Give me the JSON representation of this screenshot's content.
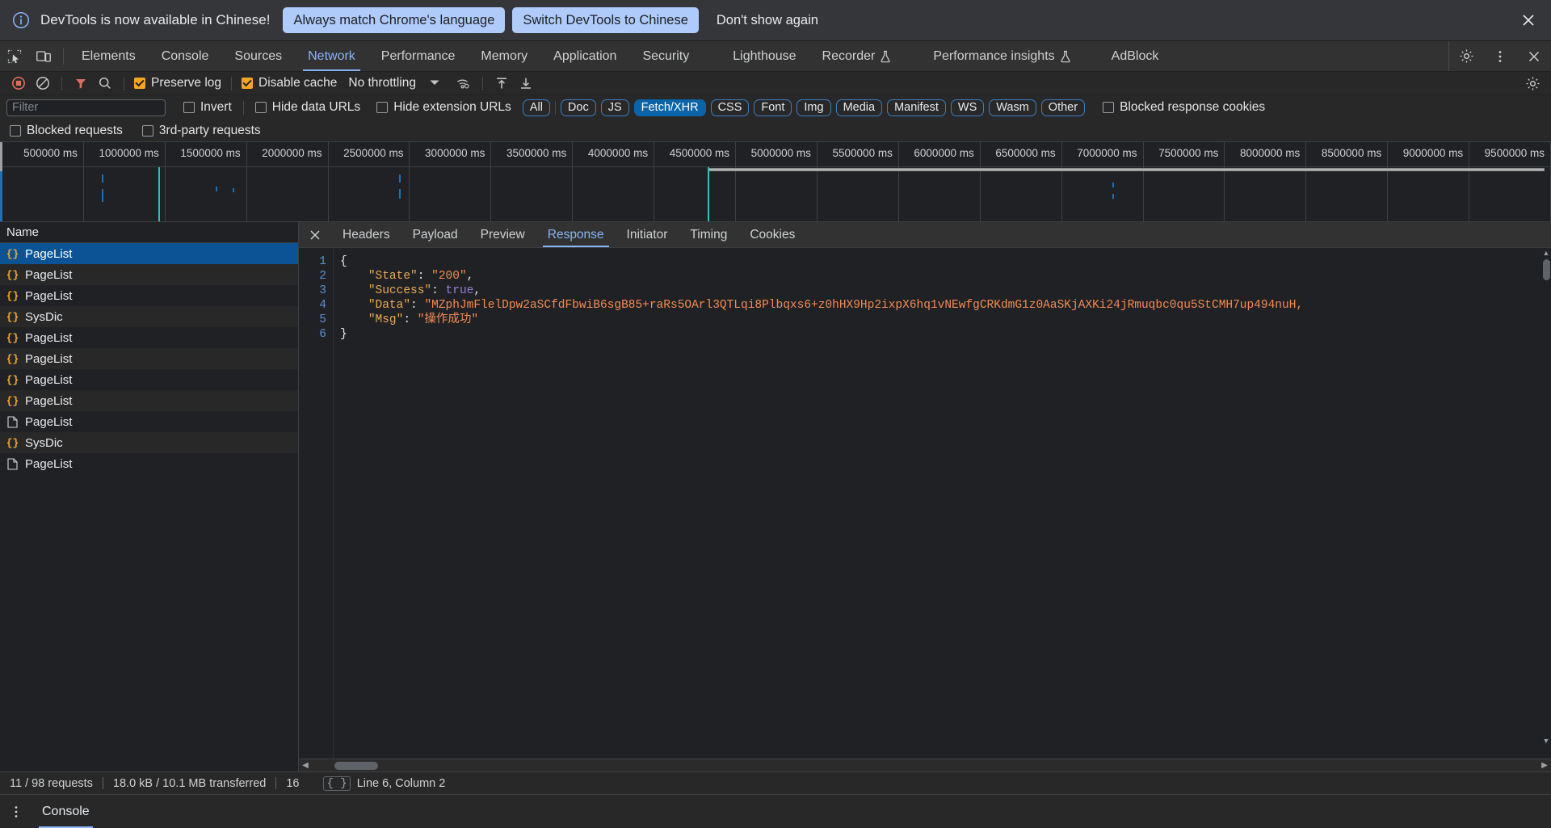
{
  "infobar": {
    "icon": "info-circle-icon",
    "message": "DevTools is now available in Chinese!",
    "primary_btn": "Always match Chrome's language",
    "secondary_btn": "Switch DevTools to Chinese",
    "dismiss_btn": "Don't show again",
    "close_icon": "close-icon",
    "accent": "#aecbfa"
  },
  "tabbar": {
    "inspect_icon": "inspect-element-icon",
    "device_icon": "device-toolbar-icon",
    "tabs": [
      {
        "label": "Elements",
        "active": false,
        "flask": false
      },
      {
        "label": "Console",
        "active": false,
        "flask": false
      },
      {
        "label": "Sources",
        "active": false,
        "flask": false
      },
      {
        "label": "Network",
        "active": true,
        "flask": false
      },
      {
        "label": "Performance",
        "active": false,
        "flask": false
      },
      {
        "label": "Memory",
        "active": false,
        "flask": false
      },
      {
        "label": "Application",
        "active": false,
        "flask": false
      },
      {
        "label": "Security",
        "active": false,
        "flask": false
      },
      {
        "label": "Lighthouse",
        "active": false,
        "flask": false
      },
      {
        "label": "Recorder",
        "active": false,
        "flask": true
      },
      {
        "label": "Performance insights",
        "active": false,
        "flask": true
      },
      {
        "label": "AdBlock",
        "active": false,
        "flask": false
      }
    ],
    "settings_icon": "gear-icon",
    "more_icon": "more-vertical-icon",
    "close_icon": "close-icon",
    "active_accent": "#8ab4f8"
  },
  "nettoolbar": {
    "record_icon": "record-stop-icon",
    "clear_icon": "clear-no-entry-icon",
    "filter_icon": "filter-funnel-icon",
    "search_icon": "search-icon",
    "preserve_log": {
      "label": "Preserve log",
      "checked": true
    },
    "disable_cache": {
      "label": "Disable cache",
      "checked": true
    },
    "throttling": "No throttling",
    "throttle_caret_icon": "chevron-down-icon",
    "wifi_icon": "network-conditions-icon",
    "import_icon": "import-har-icon",
    "export_icon": "export-har-icon",
    "settings_icon": "gear-icon"
  },
  "filterrow": {
    "filter_placeholder": "Filter",
    "filter_value": "",
    "invert": {
      "label": "Invert",
      "checked": false
    },
    "hide_data_urls": {
      "label": "Hide data URLs",
      "checked": false
    },
    "hide_extension_urls": {
      "label": "Hide extension URLs",
      "checked": false
    },
    "types": [
      {
        "label": "All",
        "selected": false
      },
      {
        "label": "Doc",
        "selected": false
      },
      {
        "label": "JS",
        "selected": false
      },
      {
        "label": "Fetch/XHR",
        "selected": true
      },
      {
        "label": "CSS",
        "selected": false
      },
      {
        "label": "Font",
        "selected": false
      },
      {
        "label": "Img",
        "selected": false
      },
      {
        "label": "Media",
        "selected": false
      },
      {
        "label": "Manifest",
        "selected": false
      },
      {
        "label": "WS",
        "selected": false
      },
      {
        "label": "Wasm",
        "selected": false
      },
      {
        "label": "Other",
        "selected": false
      }
    ],
    "blocked_response_cookies": {
      "label": "Blocked response cookies",
      "checked": false
    },
    "selected_chip_color": "#0b64a8"
  },
  "blockedrow": {
    "blocked_requests": {
      "label": "Blocked requests",
      "checked": false
    },
    "third_party": {
      "label": "3rd-party requests",
      "checked": false
    }
  },
  "overview": {
    "ticks": [
      "500000 ms",
      "1000000 ms",
      "1500000 ms",
      "2000000 ms",
      "2500000 ms",
      "3000000 ms",
      "3500000 ms",
      "4000000 ms",
      "4500000 ms",
      "5000000 ms",
      "5500000 ms",
      "6000000 ms",
      "6500000 ms",
      "7000000 ms",
      "7500000 ms",
      "8000000 ms",
      "8500000 ms",
      "9000000 ms",
      "9500000 ms"
    ],
    "tick_interval_ms": 500000,
    "marker_color": "#25c2c2",
    "bar_color": "#1f6fb2"
  },
  "requests": {
    "column_header": "Name",
    "rows": [
      {
        "name": "PageList",
        "icon": "json-icon",
        "selected": true
      },
      {
        "name": "PageList",
        "icon": "json-icon",
        "selected": false
      },
      {
        "name": "PageList",
        "icon": "json-icon",
        "selected": false
      },
      {
        "name": "SysDic",
        "icon": "json-icon",
        "selected": false
      },
      {
        "name": "PageList",
        "icon": "json-icon",
        "selected": false
      },
      {
        "name": "PageList",
        "icon": "json-icon",
        "selected": false
      },
      {
        "name": "PageList",
        "icon": "json-icon",
        "selected": false
      },
      {
        "name": "PageList",
        "icon": "json-icon",
        "selected": false
      },
      {
        "name": "PageList",
        "icon": "document-icon",
        "selected": false
      },
      {
        "name": "SysDic",
        "icon": "json-icon",
        "selected": false
      },
      {
        "name": "PageList",
        "icon": "document-icon",
        "selected": false
      }
    ]
  },
  "detail": {
    "close_icon": "close-icon",
    "tabs": [
      {
        "label": "Headers",
        "active": false
      },
      {
        "label": "Payload",
        "active": false
      },
      {
        "label": "Preview",
        "active": false
      },
      {
        "label": "Response",
        "active": true
      },
      {
        "label": "Initiator",
        "active": false
      },
      {
        "label": "Timing",
        "active": false
      },
      {
        "label": "Cookies",
        "active": false
      }
    ],
    "line_numbers": [
      "1",
      "2",
      "3",
      "4",
      "5",
      "6"
    ],
    "response": {
      "open_brace": "{",
      "close_brace": "}",
      "fields": [
        {
          "key": "\"State\"",
          "sep": ": ",
          "value": "\"200\"",
          "type": "string",
          "comma": ","
        },
        {
          "key": "\"Success\"",
          "sep": ": ",
          "value": "true",
          "type": "boolean",
          "comma": ","
        },
        {
          "key": "\"Data\"",
          "sep": ": ",
          "value": "\"MZphJmFlelDpw2aSCfdFbwiB6sgB85+raRs5OArl3QTLqi8Plbqxs6+z0hHX9Hp2ixpX6hq1vNEwfgCRKdmG1z0AaSKjAXKi24jRmuqbc0qu5StCMH7up494nuH,",
          "type": "string",
          "comma": ""
        },
        {
          "key": "\"Msg\"",
          "sep": ": ",
          "value": "\"操作成功\"",
          "type": "string",
          "comma": ""
        }
      ]
    }
  },
  "statusbar": {
    "requests": "11 / 98 requests",
    "transferred": "18.0 kB / 10.1 MB transferred",
    "resources": "16",
    "cursor_icon": "json-format-icon",
    "cursor": "Line 6, Column 2"
  },
  "drawer": {
    "more_icon": "more-vertical-icon",
    "tab": "Console"
  }
}
